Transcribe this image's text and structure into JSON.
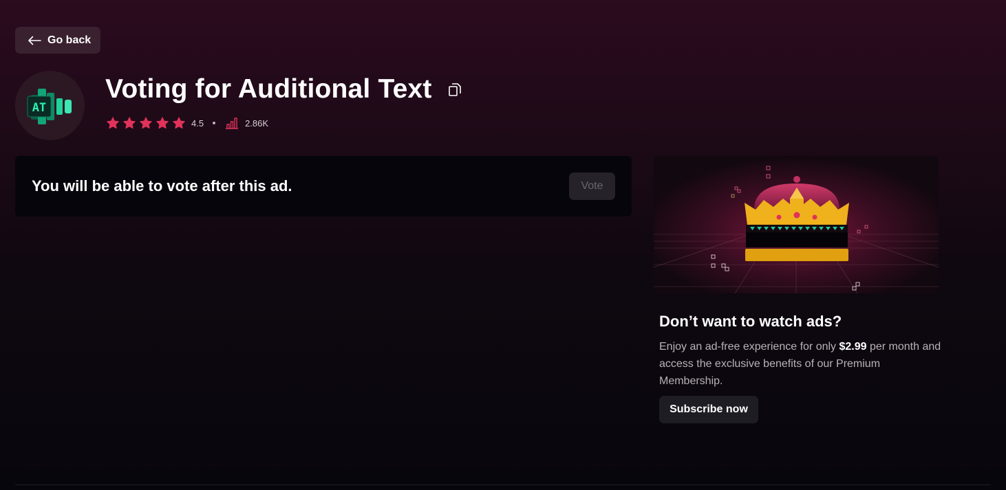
{
  "nav": {
    "back_label": "Go back"
  },
  "app": {
    "title": "Voting for Auditional Text",
    "logo_text": "AT",
    "rating": "4.5",
    "rating_stars": 5,
    "votes": "2.86K"
  },
  "ad": {
    "message": "You will be able to vote after this ad.",
    "vote_label": "Vote"
  },
  "promo": {
    "title": "Don’t want to watch ads?",
    "desc_pre": "Enjoy an ad-free experience for only ",
    "price": "$2.99",
    "desc_post": " per month and access the exclusive benefits of our Premium Membership.",
    "cta_label": "Subscribe now"
  },
  "colors": {
    "star": "#e0325a",
    "accent_pink": "#e0325a",
    "logo_green": "#1fd49a",
    "crown_gold": "#efb11c"
  }
}
